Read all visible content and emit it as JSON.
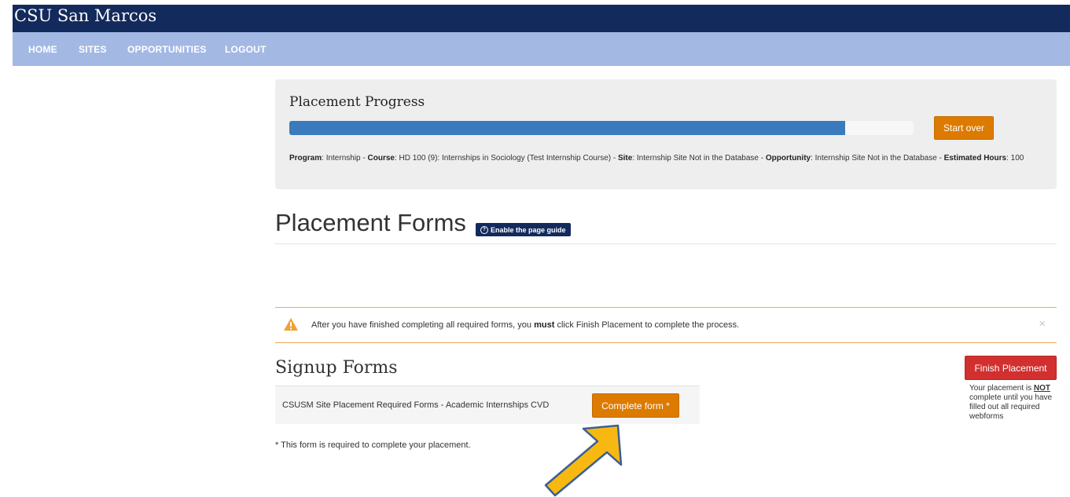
{
  "header": {
    "brand": "CSU San Marcos"
  },
  "nav": {
    "home": "HOME",
    "sites": "SITES",
    "opportunities": "OPPORTUNITIES",
    "logout": "LOGOUT"
  },
  "progress": {
    "title": "Placement Progress",
    "percent": 89,
    "start_over_label": "Start over",
    "summary": {
      "program_label": "Program",
      "program": "Internship",
      "course_label": "Course",
      "course": "HD 100 (9): Internships in Sociology (Test Internship Course)",
      "site_label": "Site",
      "site": "Internship Site Not in the Database",
      "opportunity_label": "Opportunity",
      "opportunity": "Internship Site Not in the Database",
      "hours_label": "Estimated Hours",
      "hours": "100"
    }
  },
  "page": {
    "title": "Placement Forms",
    "guide_label": "Enable the page guide"
  },
  "alert": {
    "text_before": "After you have finished completing all required forms, you",
    "emphasis": "must",
    "text_after": "click Finish Placement to complete the process.",
    "close": "×"
  },
  "signup": {
    "title": "Signup Forms",
    "forms": [
      {
        "name": "CSUSM Site Placement Required Forms - Academic Internships CVD",
        "action": "Complete form *"
      }
    ],
    "footnote": "* This form is required to complete your placement."
  },
  "finish": {
    "label": "Finish Placement",
    "note_before": "Your placement is",
    "note_emphasis": "NOT",
    "note_after": "complete until you have filled out all required webforms"
  },
  "colors": {
    "header": "#132a5c",
    "nav": "#a3b9e4",
    "progress": "#3a7bbd",
    "accent_orange": "#dd7b00",
    "finish_red": "#d22f2f",
    "arrow": "#f7b911"
  },
  "icons": {
    "warning": "warning-icon",
    "arrow": "arrow-annotation",
    "guide": "question-circle-icon"
  }
}
